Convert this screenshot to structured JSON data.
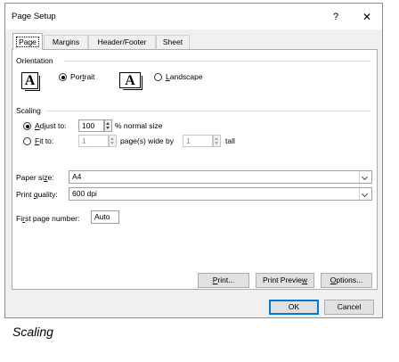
{
  "window": {
    "title": "Page Setup",
    "help_label": "?",
    "close_label": "✕"
  },
  "tabs": [
    {
      "label": "Page",
      "active": true
    },
    {
      "label": "Margins"
    },
    {
      "label": "Header/Footer"
    },
    {
      "label": "Sheet"
    }
  ],
  "orientation": {
    "heading": "Orientation",
    "icon_letter": "A",
    "portrait": {
      "pre": "Por",
      "key": "t",
      "post": "rait",
      "checked": true
    },
    "landscape": {
      "pre": "",
      "key": "L",
      "post": "andscape",
      "checked": false
    }
  },
  "scaling": {
    "heading": "Scaling",
    "adjust": {
      "pre": "",
      "key": "A",
      "post": "djust to:",
      "value": "100",
      "suffix": "% normal size",
      "checked": true
    },
    "fit": {
      "pre": "",
      "key": "F",
      "post": "it to:",
      "wide_value": "1",
      "wide_suffix": "page(s) wide by",
      "tall_value": "1",
      "tall_suffix": "tall",
      "checked": false
    }
  },
  "paper_size": {
    "pre": "Paper si",
    "key": "z",
    "post": "e:",
    "value": "A4"
  },
  "print_quality": {
    "pre": "Print ",
    "key": "q",
    "post": "uality:",
    "value": "600 dpi"
  },
  "first_page": {
    "pre": "Fi",
    "key": "r",
    "post": "st page number:",
    "value": "Auto"
  },
  "buttons": {
    "print": {
      "pre": "",
      "key": "P",
      "post": "rint..."
    },
    "preview": {
      "pre": "Print Previe",
      "key": "w",
      "post": ""
    },
    "options": {
      "pre": "",
      "key": "O",
      "post": "ptions..."
    },
    "ok": "OK",
    "cancel": "Cancel"
  },
  "caption": "Scaling",
  "colors": {
    "default_button_border": "#0078d7",
    "panel_bg": "#ffffff",
    "dialog_bg": "#f0f0f0"
  }
}
